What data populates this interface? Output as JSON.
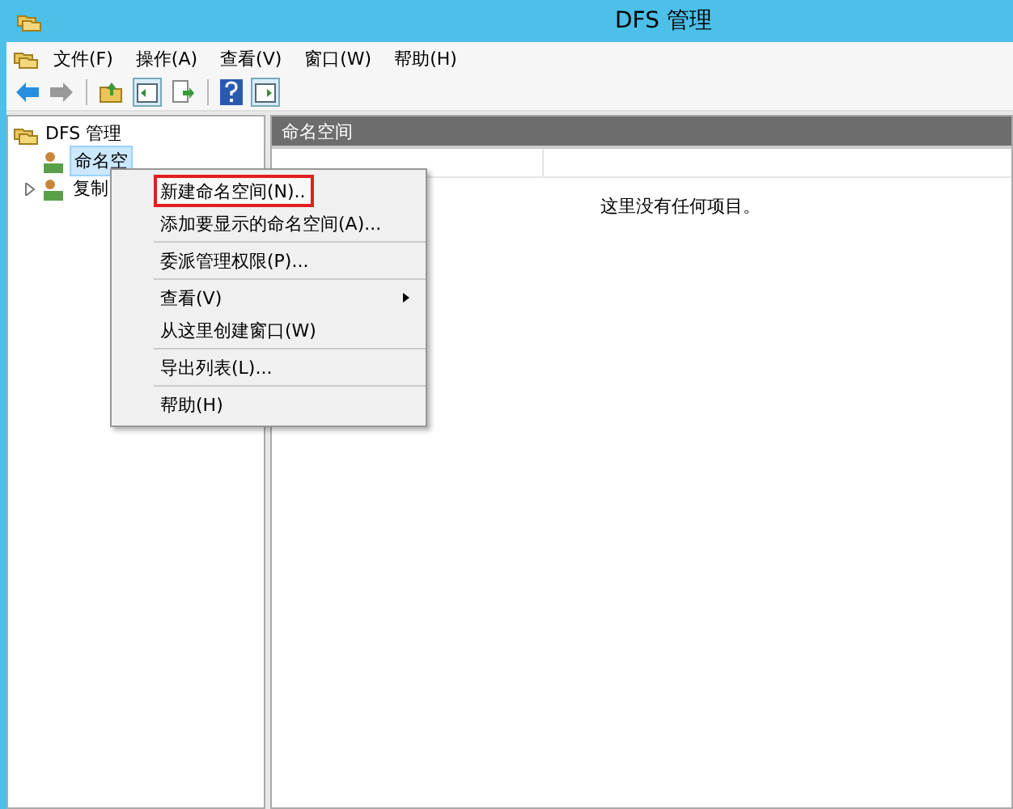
{
  "window": {
    "title": "DFS 管理"
  },
  "menu_bar": [
    {
      "label": "文件(F)"
    },
    {
      "label": "操作(A)"
    },
    {
      "label": "查看(V)"
    },
    {
      "label": "窗口(W)"
    },
    {
      "label": "帮助(H)"
    }
  ],
  "tree": [
    {
      "label": "DFS 管理",
      "selected": false,
      "children": [
        {
          "label": "命名空",
          "selected": true
        },
        {
          "label": "复制",
          "selected": false,
          "expanded": false
        }
      ]
    }
  ],
  "content": {
    "header": "命名空间",
    "empty_message": "这里没有任何项目。"
  },
  "context_menu": {
    "groups": [
      [
        {
          "label": "新建命名空间(N)..",
          "highlighted": true,
          "has_submenu": false
        },
        {
          "label": "添加要显示的命名空间(A)...",
          "highlighted": false,
          "has_submenu": false
        }
      ],
      [
        {
          "label": "委派管理权限(P)...",
          "highlighted": false,
          "has_submenu": false
        }
      ],
      [
        {
          "label": "查看(V)",
          "highlighted": false,
          "has_submenu": true
        },
        {
          "label": "从这里创建窗口(W)",
          "highlighted": false,
          "has_submenu": false
        }
      ],
      [
        {
          "label": "导出列表(L)...",
          "highlighted": false,
          "has_submenu": false
        }
      ],
      [
        {
          "label": "帮助(H)",
          "highlighted": false,
          "has_submenu": false
        }
      ]
    ]
  }
}
